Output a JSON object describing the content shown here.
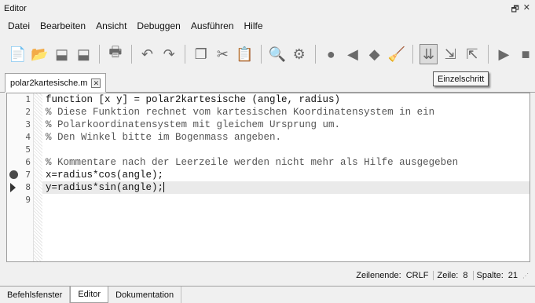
{
  "window": {
    "title": "Editor",
    "restore_glyph": "🗗",
    "close_glyph": "✕"
  },
  "menu": [
    "Datei",
    "Bearbeiten",
    "Ansicht",
    "Debuggen",
    "Ausführen",
    "Hilfe"
  ],
  "toolbar": {
    "buttons": [
      {
        "name": "new-file-icon",
        "glyph": "📄"
      },
      {
        "name": "open-folder-icon",
        "glyph": "📂"
      },
      {
        "name": "save-icon",
        "glyph": "⬓"
      },
      {
        "name": "save-all-icon",
        "glyph": "⬓"
      },
      {
        "name": "print-icon",
        "glyph": "🖶"
      },
      {
        "name": "undo-icon",
        "glyph": "↶"
      },
      {
        "name": "redo-icon",
        "glyph": "↷"
      },
      {
        "name": "copy-icon",
        "glyph": "❐"
      },
      {
        "name": "cut-icon",
        "glyph": "✂"
      },
      {
        "name": "paste-icon",
        "glyph": "📋"
      },
      {
        "name": "find-icon",
        "glyph": "🔍"
      },
      {
        "name": "settings-icon",
        "glyph": "⚙"
      },
      {
        "name": "breakpoint-icon",
        "glyph": "●"
      },
      {
        "name": "step-back-icon",
        "glyph": "◀"
      },
      {
        "name": "debug-play-icon",
        "glyph": "◆"
      },
      {
        "name": "clear-breakpoints-icon",
        "glyph": "🧹"
      },
      {
        "name": "single-step-icon",
        "glyph": "⇊"
      },
      {
        "name": "step-into-icon",
        "glyph": "⇲"
      },
      {
        "name": "step-out-icon",
        "glyph": "⇱"
      },
      {
        "name": "run-icon",
        "glyph": "▶"
      },
      {
        "name": "stop-icon",
        "glyph": "■"
      }
    ],
    "tooltip": "Einzelschritt"
  },
  "file_tab": {
    "label": "polar2kartesische.m",
    "close_glyph": "✕"
  },
  "editor": {
    "line_numbers": [
      "1",
      "2",
      "3",
      "4",
      "5",
      "6",
      "7",
      "8",
      "9"
    ],
    "lines": [
      "function [x y] = polar2kartesische (angle, radius)",
      "% Diese Funktion rechnet vom kartesischen Koordinatensystem in ein",
      "% Polarkoordinatensystem mit gleichem Ursprung um.",
      "% Den Winkel bitte im Bogenmass angeben.",
      "",
      "% Kommentare nach der Leerzeile werden nicht mehr als Hilfe ausgegeben",
      "x=radius*cos(angle);",
      "y=radius*sin(angle);",
      ""
    ],
    "breakpoint_line": 7,
    "current_line": 8
  },
  "status": {
    "line_ending_label": "Zeilenende:",
    "line_ending_value": "CRLF",
    "line_label": "Zeile:",
    "line_value": "8",
    "col_label": "Spalte:",
    "col_value": "21"
  },
  "bottom_tabs": [
    "Befehlsfenster",
    "Editor",
    "Dokumentation"
  ],
  "active_bottom_tab": "Editor"
}
